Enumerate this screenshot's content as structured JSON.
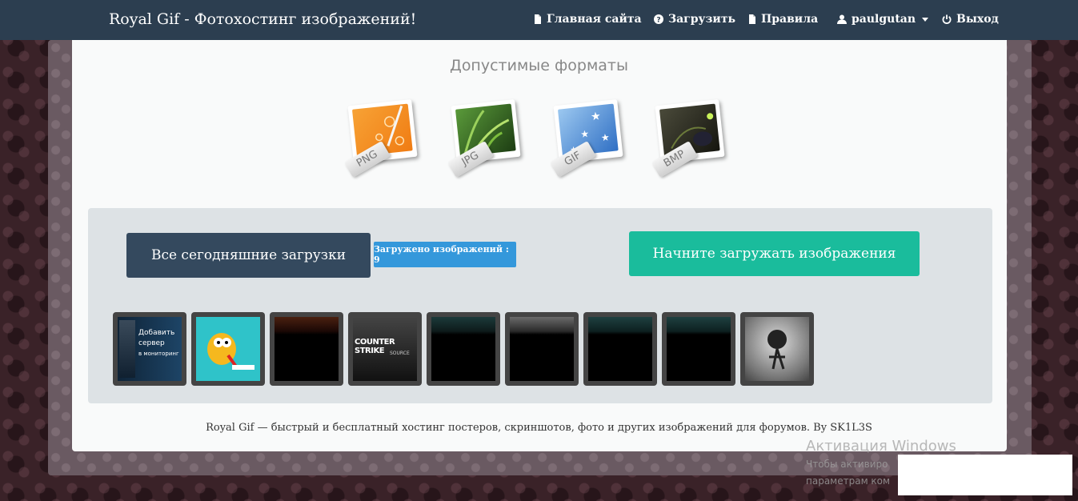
{
  "navbar": {
    "brand": "Royal Gif - Фотохостинг изображений!",
    "items": [
      {
        "label": "Главная сайта",
        "icon": "file-icon"
      },
      {
        "label": "Загрузить",
        "icon": "question-circle-icon"
      },
      {
        "label": "Правила",
        "icon": "file-icon"
      },
      {
        "label": "paulgutan",
        "icon": "user-icon"
      },
      {
        "label": "Выход",
        "icon": "power-icon"
      }
    ]
  },
  "formats": {
    "title": "Допустимые форматы",
    "items": [
      {
        "label": "PNG",
        "color": "#f5901e"
      },
      {
        "label": "JPG",
        "color": "#3f8a2a"
      },
      {
        "label": "GIF",
        "color": "#3d7fd0"
      },
      {
        "label": "BMP",
        "color": "#2a2a22"
      }
    ]
  },
  "panel": {
    "today_button": "Все сегодняшние загрузки",
    "count_badge": "Загружено изображений : 9",
    "upload_button": "Начните загружать изображения"
  },
  "thumbnails": {
    "thumb1_lines": [
      "Добавить",
      "сервер",
      "в мониторинг"
    ],
    "thumb4_text": "COUNTER STRIKE",
    "thumb4_sub": "SOURCE"
  },
  "footer": {
    "text": "Royal Gif — быстрый и бесплатный хостинг постеров, скриншотов, фото и других изображений для форумов. By SK1L3S"
  },
  "watermark": {
    "title": "Активация Windows",
    "line1": "Чтобы активиро",
    "line2": "параметрам ком"
  },
  "colors": {
    "navbar": "#2c3e50",
    "today_button": "#34495e",
    "badge": "#3498db",
    "upload_button": "#1abc9c"
  }
}
